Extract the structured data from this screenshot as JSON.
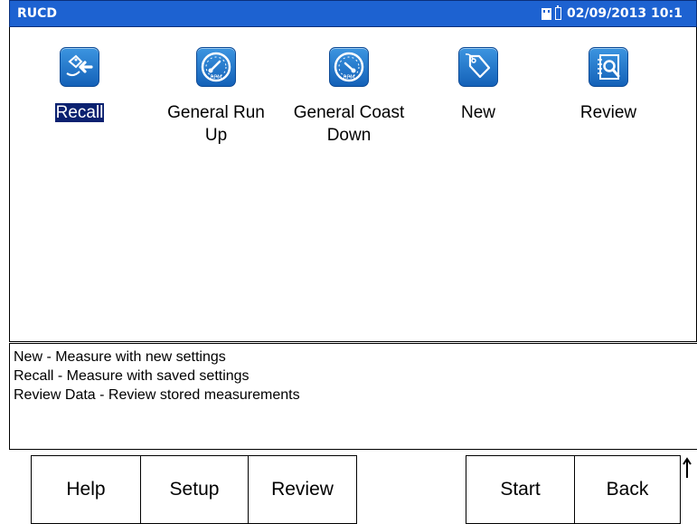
{
  "titlebar": {
    "app_title": "RUCD",
    "datetime": "02/09/2013 10:1"
  },
  "tiles": [
    {
      "label_line1": "Recall",
      "label_line2": "",
      "icon": "recall-arrow-icon",
      "selected": true
    },
    {
      "label_line1": "General Run",
      "label_line2": "Up",
      "icon": "rpm-gauge-icon",
      "selected": false
    },
    {
      "label_line1": "General Coast",
      "label_line2": "Down",
      "icon": "rpm-gauge-icon",
      "selected": false
    },
    {
      "label_line1": "New",
      "label_line2": "",
      "icon": "tag-icon",
      "selected": false
    },
    {
      "label_line1": "Review",
      "label_line2": "",
      "icon": "notebook-search-icon",
      "selected": false
    }
  ],
  "help_text": [
    "New - Measure with new settings",
    "Recall - Measure with saved settings",
    "Review Data - Review stored measurements"
  ],
  "buttons": {
    "help": "Help",
    "setup": "Setup",
    "review": "Review",
    "start": "Start",
    "back": "Back"
  },
  "colors": {
    "titlebar": "#1d62d1",
    "icon_blue": "#1f78d0",
    "selection": "#0b2170"
  }
}
